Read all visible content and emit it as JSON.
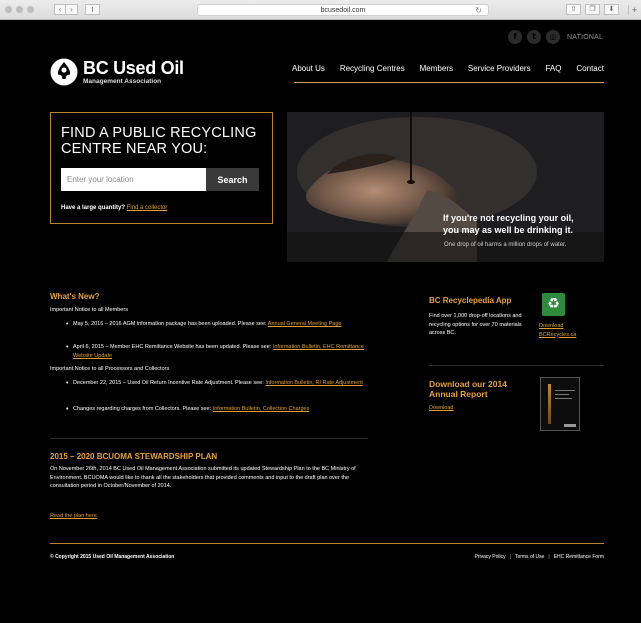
{
  "browser": {
    "url": "bcusedoil.com",
    "back": "‹",
    "forward": "›",
    "reload": "↻",
    "share": "⇧",
    "tabs": "❐",
    "download": "⬇",
    "new_tab": "+"
  },
  "social": {
    "facebook": "f",
    "twitter": "t",
    "instagram": "◎",
    "national": "NATIONAL"
  },
  "logo": {
    "title": "BC Used Oil",
    "subtitle": "Management Association"
  },
  "nav": {
    "items": [
      "About Us",
      "Recycling Centres",
      "Members",
      "Service Providers",
      "FAQ",
      "Contact"
    ]
  },
  "find": {
    "title_line1": "FIND A PUBLIC RECYCLING",
    "title_line2": "CENTRE NEAR YOU:",
    "placeholder": "Enter your location",
    "search_label": "Search",
    "large_question": "Have a large quantity?",
    "collector_link": "Find a collector"
  },
  "hero": {
    "headline_line1": "If you're not recycling your oil,",
    "headline_line2": "you may as well be drinking it.",
    "subline": "One drop of oil harms a million drops of water."
  },
  "news": {
    "title": "What's New?",
    "members_notice": "Important Notice to all Members",
    "item1_text": "May 5, 2016 – 2016 AGM information package has been uploaded. Please see: ",
    "item1_link": "Annual General Meeting Page",
    "item2_text": "April 6, 2015 – Member EHC Remittance Website has been updated. Please see: ",
    "item2_link": "Information Bulletin, EHC Remittance Website Update",
    "processors_notice": "Important Notice to all Processors and Collectors",
    "item3_text": "December 22, 2015 – Used Oil Return Incentive Rate Adjustment. Please see: ",
    "item3_link": "Information Bulletin, RI Rate Adjustment",
    "item4_text": "Changes regarding charges from Collectors. Please see: ",
    "item4_link": "Information Bulletin, Collection Charges"
  },
  "plan": {
    "title": "2015 – 2020 BCUOMA STEWARDSHIP PLAN",
    "body": "On November 26th, 2014 BC Used Oil Management Association submitted its updated Stewardship Plan to the BC Ministry of Environment. BCUOMA would like to thank all the stakeholders that provided comments and input to the draft plan over the consultation period in October/November of 2014.",
    "link": "Read the plan here"
  },
  "app": {
    "title": "BC Recyclepedia App",
    "description": "Find over 1,000 drop-off locations and recycling options for over 70 materials across BC.",
    "icon_glyph": "♻",
    "download_label": "Download",
    "site_label": "BCRecycles.ca"
  },
  "report": {
    "title_line1": "Download our 2014",
    "title_line2": "Annual Report",
    "link": "Download"
  },
  "footer": {
    "copyright": "© Copyright 2015 Used Oil Management Association",
    "links": [
      "Privacy Policy",
      "Terms of Use",
      "EHC Remittance Form"
    ],
    "separator": "|"
  },
  "colors": {
    "accent": "#e6a134",
    "link": "#e0a030",
    "border": "#b8862b",
    "background": "#000000"
  }
}
